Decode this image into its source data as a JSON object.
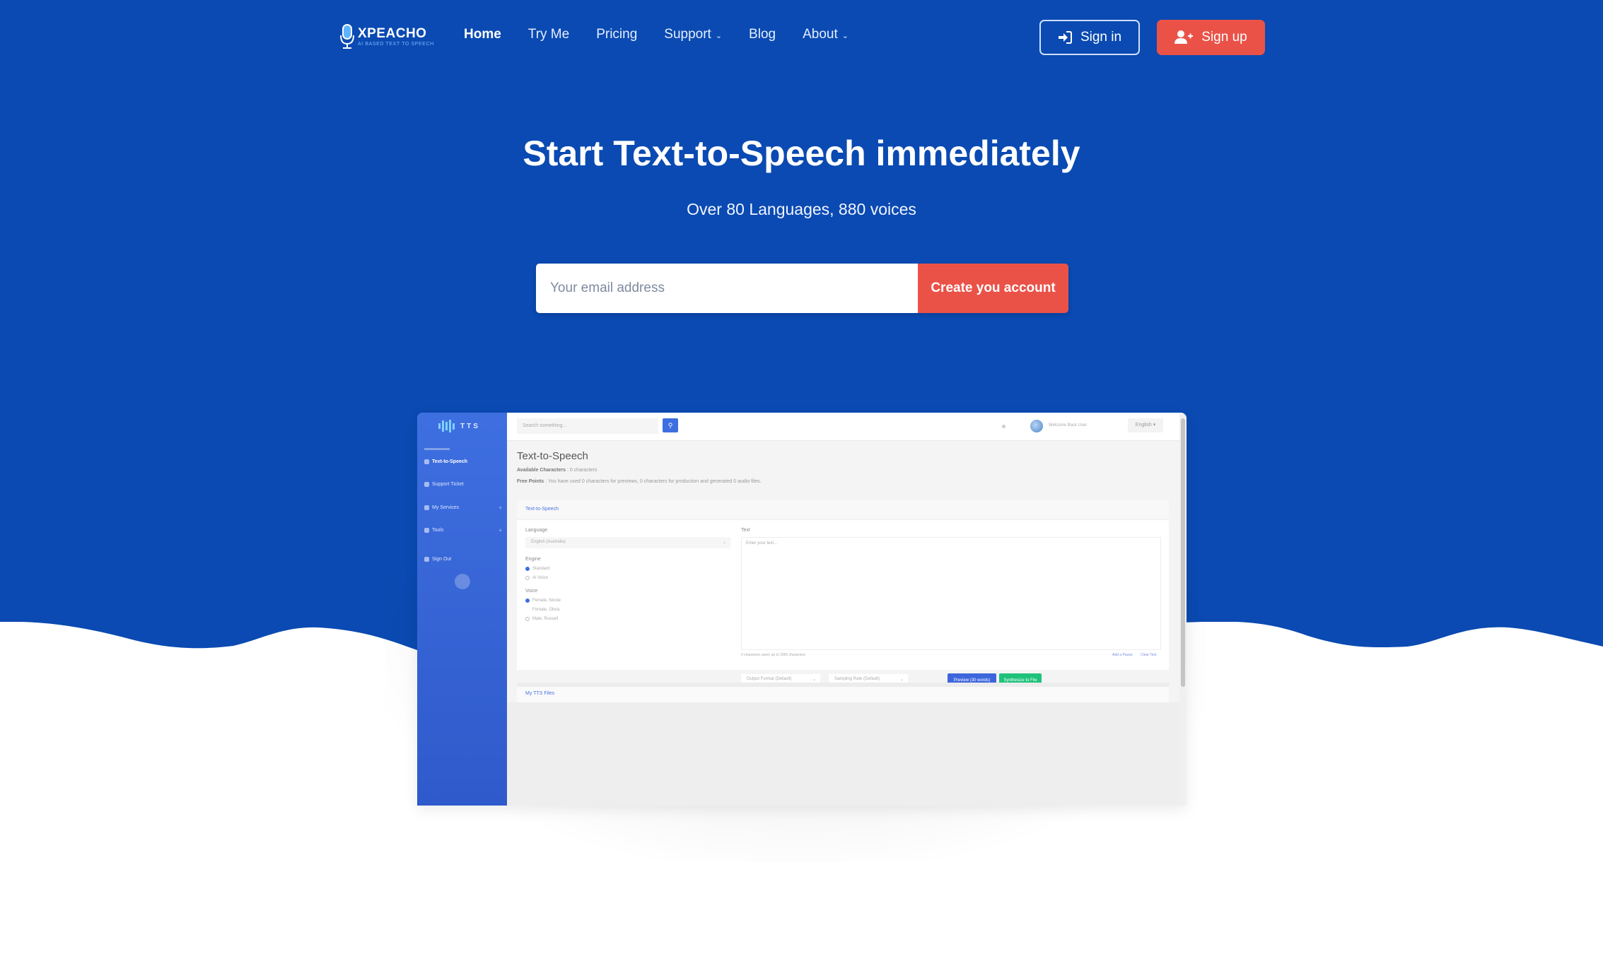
{
  "brand": {
    "name": "XPEACHO",
    "tagline": "AI BASED TEXT TO SPEECH",
    "primary_color": "#0a4ab2",
    "accent_color": "#ea5248"
  },
  "nav": {
    "links": [
      {
        "label": "Home",
        "active": true,
        "dropdown": false
      },
      {
        "label": "Try Me",
        "active": false,
        "dropdown": false
      },
      {
        "label": "Pricing",
        "active": false,
        "dropdown": false
      },
      {
        "label": "Support",
        "active": false,
        "dropdown": true
      },
      {
        "label": "Blog",
        "active": false,
        "dropdown": false
      },
      {
        "label": "About",
        "active": false,
        "dropdown": true
      }
    ],
    "sign_in": {
      "label": "Sign in",
      "icon": "sign-in-icon"
    },
    "sign_up": {
      "label": "Sign up",
      "icon": "user-plus-icon"
    }
  },
  "hero": {
    "title": "Start Text-to-Speech immediately",
    "subtitle": "Over 80 Languages, 880 voices",
    "email_placeholder": "Your email address",
    "cta_label": "Create you account"
  },
  "preview": {
    "logo_text": "TTS",
    "sidebar": [
      {
        "label": "Text-to-Speech",
        "icon": "mic-icon",
        "expandable": false
      },
      {
        "label": "Support Ticket",
        "icon": "ticket-icon",
        "expandable": false
      },
      {
        "label": "My Services",
        "icon": "list-icon",
        "expandable": true
      },
      {
        "label": "Tools",
        "icon": "tool-icon",
        "expandable": true
      },
      {
        "label": "Sign Out",
        "icon": "power-icon",
        "expandable": false
      }
    ],
    "search_placeholder": "Search something...",
    "user_name": "Welcome Back User",
    "language_selector": "English",
    "page_title": "Text-to-Speech",
    "available_characters_label": "Available Characters",
    "available_characters_value": "0 characters",
    "free_points_label": "Free Points",
    "free_points_text": "You have used 0 characters for previews, 0 characters for production and generated 0 audio files.",
    "card_title": "Text-to-Speech",
    "language_label": "Language",
    "language_value": "English (Australia)",
    "engine_label": "Engine",
    "engines": [
      {
        "label": "Standard",
        "selected": true
      },
      {
        "label": "AI Voice",
        "selected": false
      }
    ],
    "voice_label": "Voice",
    "voices": [
      {
        "label": "Female, Nicole",
        "selected": true
      },
      {
        "label": "Female, Olivia",
        "selected": false
      },
      {
        "label": "Male, Russell",
        "selected": false
      }
    ],
    "text_label": "Text",
    "text_placeholder": "Enter your text...",
    "char_hint": "0 characters used, up to 3000 characters",
    "add_pause": "Add a Pause",
    "clear_text": "Clear Text",
    "output_format": "Output Format (Default)",
    "sampling_rate": "Sampling Rate (Default)",
    "preview_button": "Preview (30 words)",
    "synthesize_button": "Synthesize to File",
    "files_title": "My TTS Files"
  }
}
